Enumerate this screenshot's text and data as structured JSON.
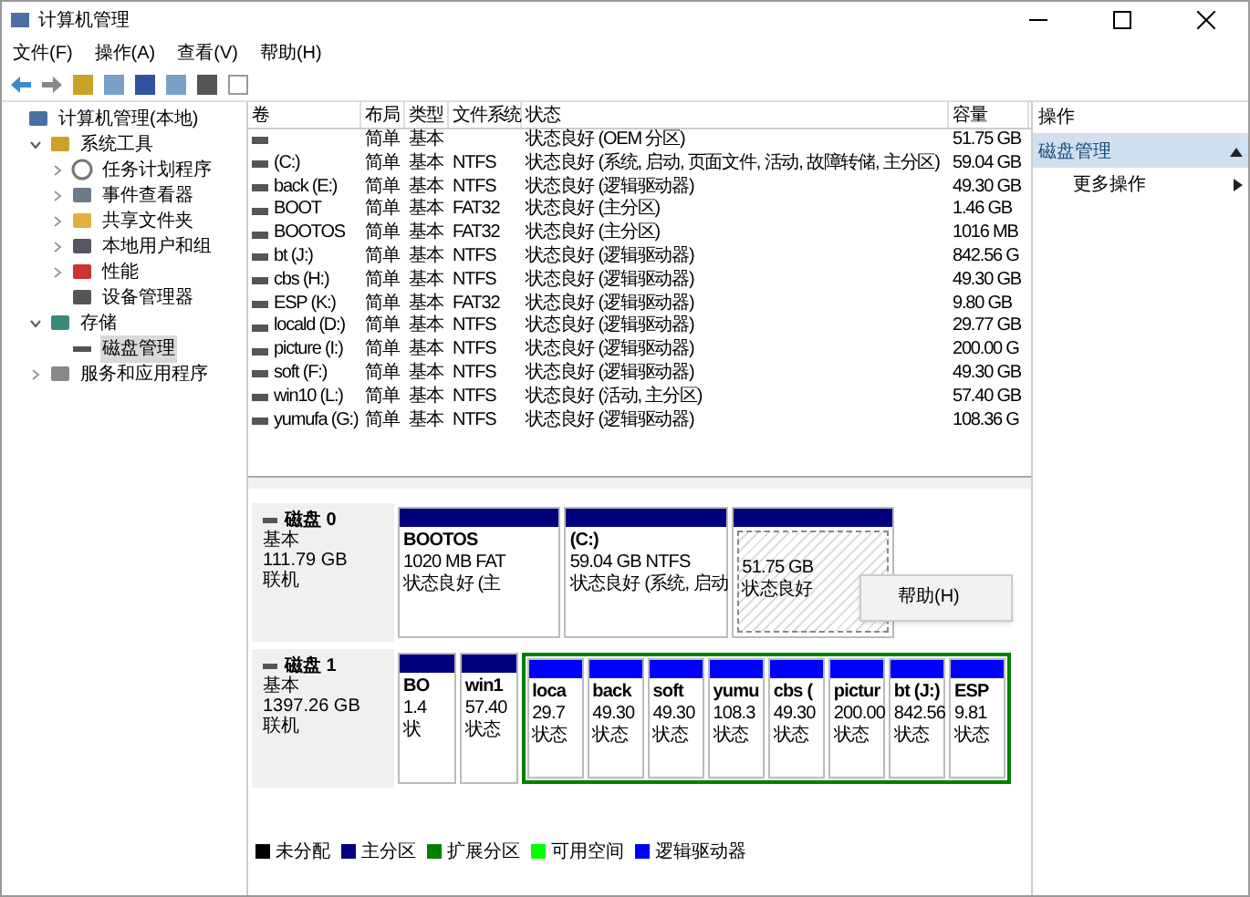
{
  "window": {
    "title": "计算机管理"
  },
  "menu": [
    "文件(F)",
    "操作(A)",
    "查看(V)",
    "帮助(H)"
  ],
  "tree": [
    {
      "label": "计算机管理(本地)",
      "selected": false,
      "children": [
        {
          "label": "系统工具",
          "selected": false,
          "expanded": true,
          "children": [
            {
              "label": "任务计划程序",
              "selected": false,
              "expanded": false
            },
            {
              "label": "事件查看器",
              "selected": false,
              "expanded": false
            },
            {
              "label": "共享文件夹",
              "selected": false,
              "expanded": false
            },
            {
              "label": "本地用户和组",
              "selected": false,
              "expanded": false
            },
            {
              "label": "性能",
              "selected": false,
              "expanded": false
            },
            {
              "label": "设备管理器",
              "selected": false
            }
          ]
        },
        {
          "label": "存储",
          "selected": false,
          "expanded": true,
          "children": [
            {
              "label": "磁盘管理",
              "selected": true
            }
          ]
        },
        {
          "label": "服务和应用程序",
          "selected": false,
          "expanded": false
        }
      ]
    }
  ],
  "table": {
    "columns": [
      "卷",
      "布局",
      "类型",
      "文件系统",
      "状态",
      "容量"
    ],
    "rows": [
      [
        "",
        "简单",
        "基本",
        "",
        "状态良好 (OEM 分区)",
        "51.75 GB"
      ],
      [
        "(C:)",
        "简单",
        "基本",
        "NTFS",
        "状态良好 (系统, 启动, 页面文件, 活动, 故障转储, 主分区)",
        "59.04 GB"
      ],
      [
        "back (E:)",
        "简单",
        "基本",
        "NTFS",
        "状态良好 (逻辑驱动器)",
        "49.30 GB"
      ],
      [
        "BOOT",
        "简单",
        "基本",
        "FAT32",
        "状态良好 (主分区)",
        "1.46 GB"
      ],
      [
        "BOOTOS",
        "简单",
        "基本",
        "FAT32",
        "状态良好 (主分区)",
        "1016 MB"
      ],
      [
        "bt (J:)",
        "简单",
        "基本",
        "NTFS",
        "状态良好 (逻辑驱动器)",
        "842.56 G"
      ],
      [
        "cbs (H:)",
        "简单",
        "基本",
        "NTFS",
        "状态良好 (逻辑驱动器)",
        "49.30 GB"
      ],
      [
        "ESP (K:)",
        "简单",
        "基本",
        "FAT32",
        "状态良好 (逻辑驱动器)",
        "9.80 GB"
      ],
      [
        "locald (D:)",
        "简单",
        "基本",
        "NTFS",
        "状态良好 (逻辑驱动器)",
        "29.77 GB"
      ],
      [
        "picture (I:)",
        "简单",
        "基本",
        "NTFS",
        "状态良好 (逻辑驱动器)",
        "200.00 G"
      ],
      [
        "soft (F:)",
        "简单",
        "基本",
        "NTFS",
        "状态良好 (逻辑驱动器)",
        "49.30 GB"
      ],
      [
        "win10 (L:)",
        "简单",
        "基本",
        "NTFS",
        "状态良好 (活动, 主分区)",
        "57.40 GB"
      ],
      [
        "yumufa (G:)",
        "简单",
        "基本",
        "NTFS",
        "状态良好 (逻辑驱动器)",
        "108.36 G"
      ]
    ]
  },
  "disks": [
    {
      "name": "磁盘 0",
      "type": "基本",
      "size": "111.79 GB",
      "status": "联机",
      "partitions": [
        {
          "kind": "primary",
          "selected": false,
          "lines": [
            "BOOTOS",
            "1020 MB FAT",
            "状态良好 (主"
          ]
        },
        {
          "kind": "primary",
          "selected": false,
          "lines": [
            "(C:)",
            "59.04 GB NTFS",
            "状态良好 (系统, 启动"
          ]
        },
        {
          "kind": "primary",
          "selected": true,
          "lines": [
            "51.75 GB",
            "状态良好"
          ]
        }
      ]
    },
    {
      "name": "磁盘 1",
      "type": "基本",
      "size": "1397.26 GB",
      "status": "联机",
      "partitions": [
        {
          "kind": "primary",
          "selected": false,
          "lines": [
            "BO",
            "1.4",
            "状"
          ]
        },
        {
          "kind": "primary",
          "selected": false,
          "lines": [
            "win1",
            "57.40",
            "状态"
          ]
        },
        {
          "kind": "logical",
          "selected": false,
          "lines": [
            "loca",
            "29.7",
            "状态"
          ]
        },
        {
          "kind": "logical",
          "selected": false,
          "lines": [
            "back",
            "49.30",
            "状态"
          ]
        },
        {
          "kind": "logical",
          "selected": false,
          "lines": [
            "soft",
            "49.30",
            "状态"
          ]
        },
        {
          "kind": "logical",
          "selected": false,
          "lines": [
            "yumu",
            "108.3",
            "状态"
          ]
        },
        {
          "kind": "logical",
          "selected": false,
          "lines": [
            "cbs (",
            "49.30",
            "状态"
          ]
        },
        {
          "kind": "logical",
          "selected": false,
          "lines": [
            "pictur",
            "200.00",
            "状态"
          ]
        },
        {
          "kind": "logical",
          "selected": false,
          "lines": [
            "bt (J:)",
            "842.56",
            "状态"
          ]
        },
        {
          "kind": "logical",
          "selected": false,
          "lines": [
            "ESP",
            "9.81",
            "状态"
          ]
        }
      ]
    }
  ],
  "context_menu": [
    "帮助(H)"
  ],
  "legend": [
    {
      "label": "未分配",
      "color": "#000000"
    },
    {
      "label": "主分区",
      "color": "#00007f"
    },
    {
      "label": "扩展分区",
      "color": "#008000"
    },
    {
      "label": "可用空间",
      "color": "#00ff00"
    },
    {
      "label": "逻辑驱动器",
      "color": "#0000ff"
    }
  ],
  "actions": {
    "title": "操作",
    "section": "磁盘管理",
    "items": [
      "更多操作"
    ]
  }
}
